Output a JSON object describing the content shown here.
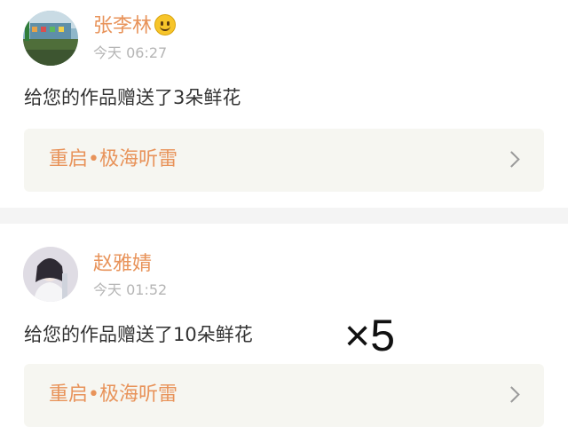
{
  "notifications": [
    {
      "user": {
        "name": "张李林",
        "has_emoji": true
      },
      "time": "今天 06:27",
      "message": "给您的作品赠送了3朵鲜花",
      "work_title": "重启•极海听雷"
    },
    {
      "user": {
        "name": "赵雅婧",
        "has_emoji": false
      },
      "time": "今天 01:52",
      "message": "给您的作品赠送了10朵鲜花",
      "work_title": "重启•极海听雷",
      "overlay_text": "×5"
    }
  ],
  "colors": {
    "accent": "#e8935a",
    "time_text": "#b5b5b5",
    "message_text": "#333333",
    "work_box_bg": "#f6f6f1",
    "divider": "#f4f4f4"
  },
  "icons": [
    "smile-emoji-icon",
    "chevron-right-icon"
  ]
}
